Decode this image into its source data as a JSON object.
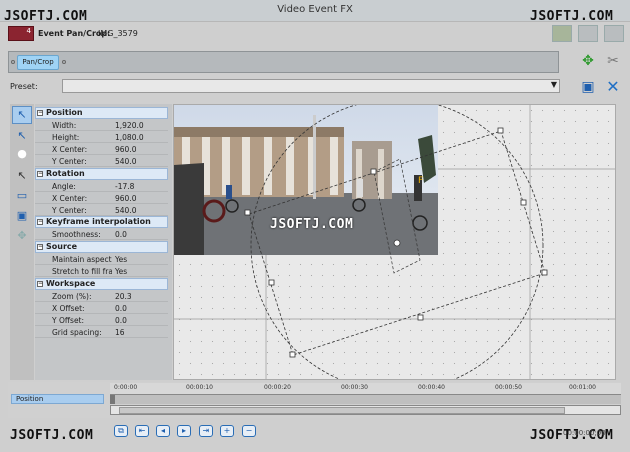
{
  "window": {
    "title": "Video Event FX"
  },
  "watermark": {
    "text": "JSOFTJ.COM"
  },
  "header": {
    "label": "Event Pan/Crop:",
    "value": "IMG_3579",
    "badge": "4"
  },
  "chain": {
    "pill": "Pan/Crop"
  },
  "preset": {
    "label": "Preset:",
    "value": ""
  },
  "sections": [
    {
      "title": "Position",
      "rows": [
        {
          "k": "Width:",
          "v": "1,920.0"
        },
        {
          "k": "Height:",
          "v": "1,080.0"
        },
        {
          "k": "X Center:",
          "v": "960.0"
        },
        {
          "k": "Y Center:",
          "v": "540.0"
        }
      ]
    },
    {
      "title": "Rotation",
      "rows": [
        {
          "k": "Angle:",
          "v": "-17.8"
        },
        {
          "k": "X Center:",
          "v": "960.0"
        },
        {
          "k": "Y Center:",
          "v": "540.0"
        }
      ]
    },
    {
      "title": "Keyframe interpolation",
      "rows": [
        {
          "k": "Smoothness:",
          "v": "0.0"
        }
      ]
    },
    {
      "title": "Source",
      "rows": [
        {
          "k": "Maintain aspect ...",
          "v": "Yes"
        },
        {
          "k": "Stretch to fill fra...",
          "v": "Yes"
        }
      ]
    },
    {
      "title": "Workspace",
      "rows": [
        {
          "k": "Zoom (%):",
          "v": "20.3"
        },
        {
          "k": "X Offset:",
          "v": "0.0"
        },
        {
          "k": "Y Offset:",
          "v": "0.0"
        },
        {
          "k": "Grid spacing:",
          "v": "16"
        }
      ]
    }
  ],
  "timeline": {
    "track_label": "Position",
    "ticks": [
      "0:00:00",
      "00:00:10",
      "00:00:20",
      "00:00:30",
      "00:00:40",
      "00:00:50",
      "00:01:00"
    ],
    "timecode": "00:00:00;00"
  },
  "icons": {
    "move": "green-move-arrows-icon",
    "cut": "scissors-icon",
    "save": "save-disk-icon",
    "close": "close-x-icon"
  },
  "colors": {
    "accent": "#9fd3f5",
    "selection": "#a9cdef",
    "badge": "#8b2430"
  }
}
